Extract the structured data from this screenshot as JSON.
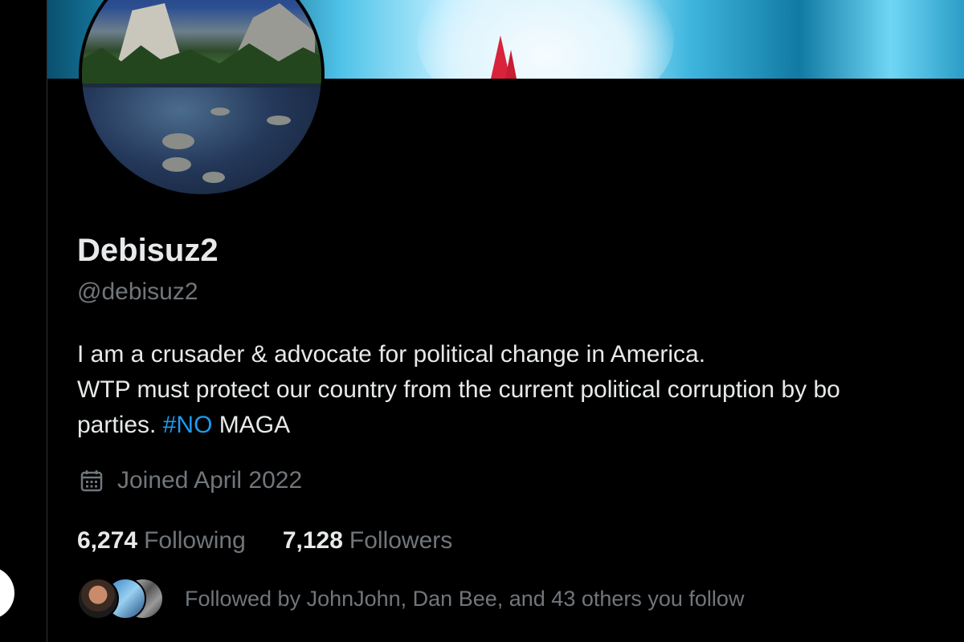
{
  "profile": {
    "display_name": "Debisuz2",
    "handle": "@debisuz2",
    "bio_line1": "I am a crusader & advocate for political change in America.",
    "bio_line2": "WTP must protect our country from the current political corruption by bo",
    "bio_line3_prefix": "parties. ",
    "bio_hashtag": "#NO",
    "bio_line3_suffix": " MAGA",
    "joined_icon": "calendar-icon",
    "joined": "Joined April 2022",
    "following_count": "6,274",
    "following_label": "Following",
    "followers_count": "7,128",
    "followers_label": "Followers",
    "followed_by": "Followed by JohnJohn, Dan Bee, and 43 others you follow"
  },
  "colors": {
    "background": "#000000",
    "primary_text": "#e7e9ea",
    "secondary_text": "#71767b",
    "hashtag": "#1d9bf0"
  }
}
